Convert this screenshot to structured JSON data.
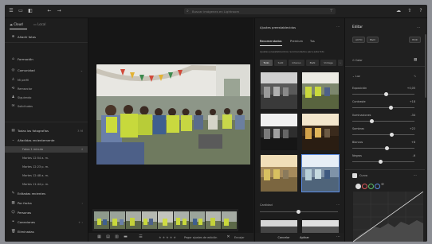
{
  "topbar": {
    "search_placeholder": "Buscar imágenes en Lightroom"
  },
  "sidebar": {
    "tabs": [
      "Cloud",
      "Local"
    ],
    "add_label": "Añadir fotos",
    "items": [
      {
        "label": "Formación",
        "icon": "school-icon"
      },
      {
        "label": "Comunidad",
        "icon": "community-icon"
      },
      {
        "label": "Mi perfil",
        "icon": "profile-icon"
      },
      {
        "label": "Remezclar",
        "icon": "remix-icon"
      },
      {
        "label": "Siguiendo",
        "icon": "following-icon"
      },
      {
        "label": "Solicitudes",
        "icon": "requests-icon"
      }
    ],
    "library_header": "Todas las fotografías",
    "library_count": "3 M",
    "sub_header": "Añadidas recientemente",
    "sub_items": [
      {
        "label": "Fotos 1 minuto",
        "count": "4",
        "selected": true
      },
      {
        "label": "Martes 12:54 a. m.",
        "count": "",
        "selected": false
      },
      {
        "label": "Martes 12:23 p. m.",
        "count": "",
        "selected": false
      },
      {
        "label": "Martes 12:48 a. m.",
        "count": "",
        "selected": false
      },
      {
        "label": "Martes 11:44 p. m.",
        "count": "",
        "selected": false
      }
    ],
    "bottom_items": [
      {
        "label": "Editadas recientes",
        "icon": "edited-icon"
      },
      {
        "label": "Por fecha",
        "icon": "date-icon"
      },
      {
        "label": "Personas",
        "icon": "people-icon"
      },
      {
        "label": "Conexiones",
        "icon": "connections-icon"
      },
      {
        "label": "Eliminadas",
        "icon": "trash-icon"
      }
    ]
  },
  "center": {
    "stars": "★★★★★",
    "copy_text": "Pegar ajustes de edición",
    "zoom_label": "Encajar",
    "zoom_value": "100 %"
  },
  "presets": {
    "title": "Ajustes preestablecidos",
    "tabs": [
      "Recomendados",
      "Premium",
      "Tus"
    ],
    "description": "Ajustes preestablecidos recomendados para esta foto",
    "chips": [
      "Todo",
      "Sutil",
      "Intenso",
      "B&N",
      "Vintage"
    ],
    "amount_label": "Cantidad",
    "cancel": "Cancelar",
    "apply": "Aplicar"
  },
  "edit": {
    "title": "Editar",
    "pills": [
      "AUTO",
      "B&N",
      "HDR"
    ],
    "profile": "Color",
    "section": "Luz",
    "sliders": [
      {
        "label": "Exposición",
        "value": "+0,05",
        "pos": 0.55
      },
      {
        "label": "Contraste",
        "value": "+18",
        "pos": 0.62
      },
      {
        "label": "Iluminaciones",
        "value": "-34",
        "pos": 0.32
      },
      {
        "label": "Sombras",
        "value": "+22",
        "pos": 0.64
      },
      {
        "label": "Blancos",
        "value": "+8",
        "pos": 0.56
      },
      {
        "label": "Negros",
        "value": "-6",
        "pos": 0.46
      }
    ],
    "curve_title": "Curva"
  }
}
